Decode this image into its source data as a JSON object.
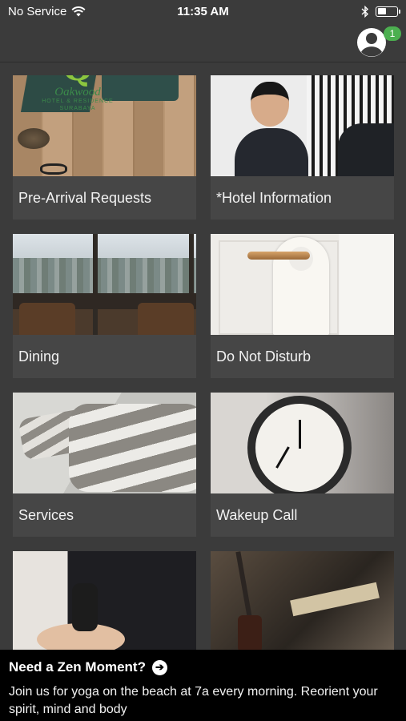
{
  "status_bar": {
    "carrier": "No Service",
    "time": "11:35 AM",
    "battery_level": 0.45
  },
  "header": {
    "notification_count": "1"
  },
  "logo": {
    "brand": "Oakwood",
    "subtitle": "HOTEL & RESIDENCE",
    "city": "SURABAYA"
  },
  "tiles": [
    {
      "label": "Pre-Arrival Requests"
    },
    {
      "label": "*Hotel Information"
    },
    {
      "label": "Dining"
    },
    {
      "label": "Do Not Disturb"
    },
    {
      "label": "Services"
    },
    {
      "label": "Wakeup Call"
    },
    {
      "label": ""
    },
    {
      "label": ""
    }
  ],
  "banner": {
    "title": "Need a Zen Moment?",
    "body": "Join us for yoga on the beach at 7a every morning. Reorient your spirit, mind and body"
  },
  "icons": {
    "wifi": "wifi-icon",
    "bluetooth": "bluetooth-icon",
    "battery": "battery-icon",
    "profile": "user-edit-icon",
    "banner_arrow": "arrow-right-circle-icon"
  }
}
